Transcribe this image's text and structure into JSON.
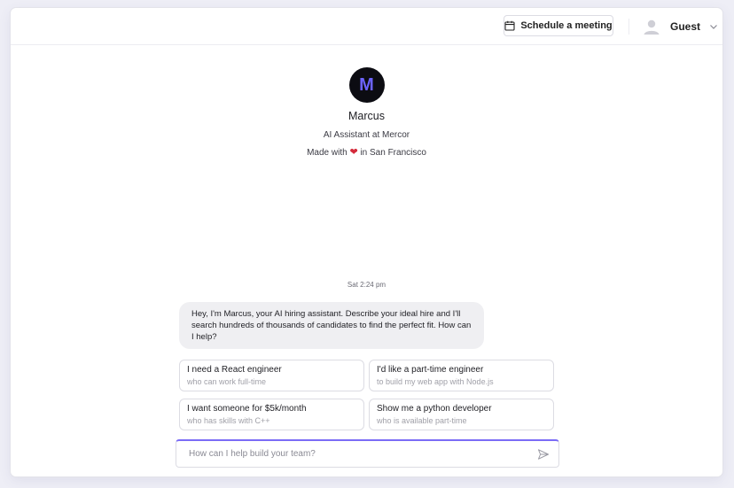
{
  "header": {
    "schedule_label": "Schedule a meeting",
    "user_name": "Guest"
  },
  "profile": {
    "logo_letter": "M",
    "name": "Marcus",
    "role": "AI Assistant at Mercor",
    "made_with_prefix": "Made with",
    "made_with_suffix": "in San Francisco"
  },
  "chat": {
    "timestamp": "Sat 2:24 pm",
    "messages": [
      {
        "text": "Hey, I'm Marcus, your AI hiring assistant. Describe your ideal hire and I'll search hundreds of thousands of candidates to find the perfect fit. How can I help?"
      }
    ]
  },
  "suggestions": [
    {
      "title": "I need a React engineer",
      "subtitle": "who can work full-time"
    },
    {
      "title": "I'd like a part-time engineer",
      "subtitle": "to build my web app with Node.js"
    },
    {
      "title": "I want someone for $5k/month",
      "subtitle": "who has skills with C++"
    },
    {
      "title": "Show me a python developer",
      "subtitle": "who is available part-time"
    }
  ],
  "input": {
    "placeholder": "How can I help build your team?",
    "value": ""
  },
  "icons": {
    "schedule": "calendar-icon",
    "user": "user-avatar-icon",
    "dropdown": "chevron-down-icon",
    "send": "send-icon",
    "made_with": "heart-icon"
  },
  "colors": {
    "accent": "#7b6cf6",
    "logo_bg": "#0c0c12",
    "logo_letter": "#6c63ff",
    "heart": "#d42a3a",
    "bubble_bg": "#efeff2"
  }
}
